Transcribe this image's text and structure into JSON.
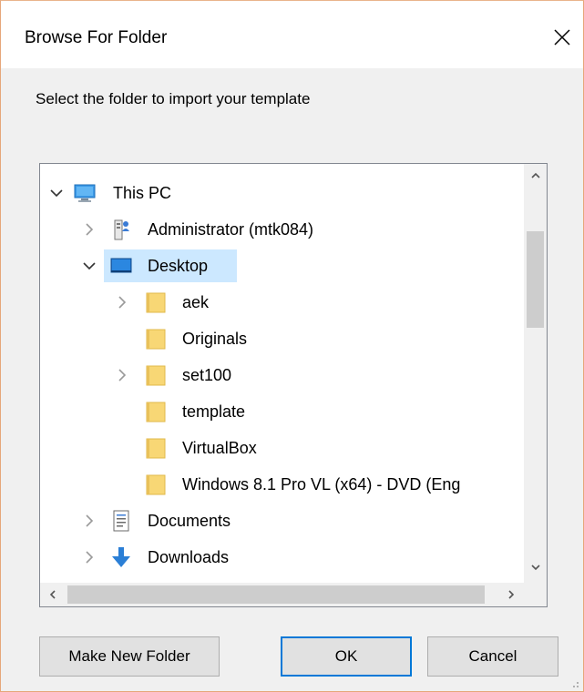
{
  "window": {
    "title": "Browse For Folder",
    "close_glyph": "✕"
  },
  "prompt": "Select the folder to import your template",
  "tree": {
    "items": [
      {
        "label": "This PC",
        "icon": "computer-icon",
        "expander": "expanded"
      },
      {
        "label": "Administrator (mtk084)",
        "icon": "user-folder-icon",
        "expander": "collapsed"
      },
      {
        "label": "Desktop",
        "icon": "desktop-icon",
        "expander": "expanded",
        "selected": true
      },
      {
        "label": "aek",
        "icon": "folder-icon",
        "expander": "collapsed"
      },
      {
        "label": "Originals",
        "icon": "folder-icon",
        "expander": "none"
      },
      {
        "label": "set100",
        "icon": "folder-icon",
        "expander": "collapsed"
      },
      {
        "label": "template",
        "icon": "folder-icon",
        "expander": "none"
      },
      {
        "label": "VirtualBox",
        "icon": "folder-icon",
        "expander": "none"
      },
      {
        "label": "Windows 8.1 Pro VL (x64) - DVD (Eng",
        "icon": "folder-icon",
        "expander": "none"
      },
      {
        "label": "Documents",
        "icon": "documents-icon",
        "expander": "collapsed"
      },
      {
        "label": "Downloads",
        "icon": "downloads-icon",
        "expander": "collapsed"
      }
    ]
  },
  "buttons": {
    "make_new_folder": "Make New Folder",
    "ok": "OK",
    "cancel": "Cancel"
  },
  "colors": {
    "selection": "#cce8ff",
    "default_button_border": "#0078d7",
    "folder": "#f8d775"
  }
}
